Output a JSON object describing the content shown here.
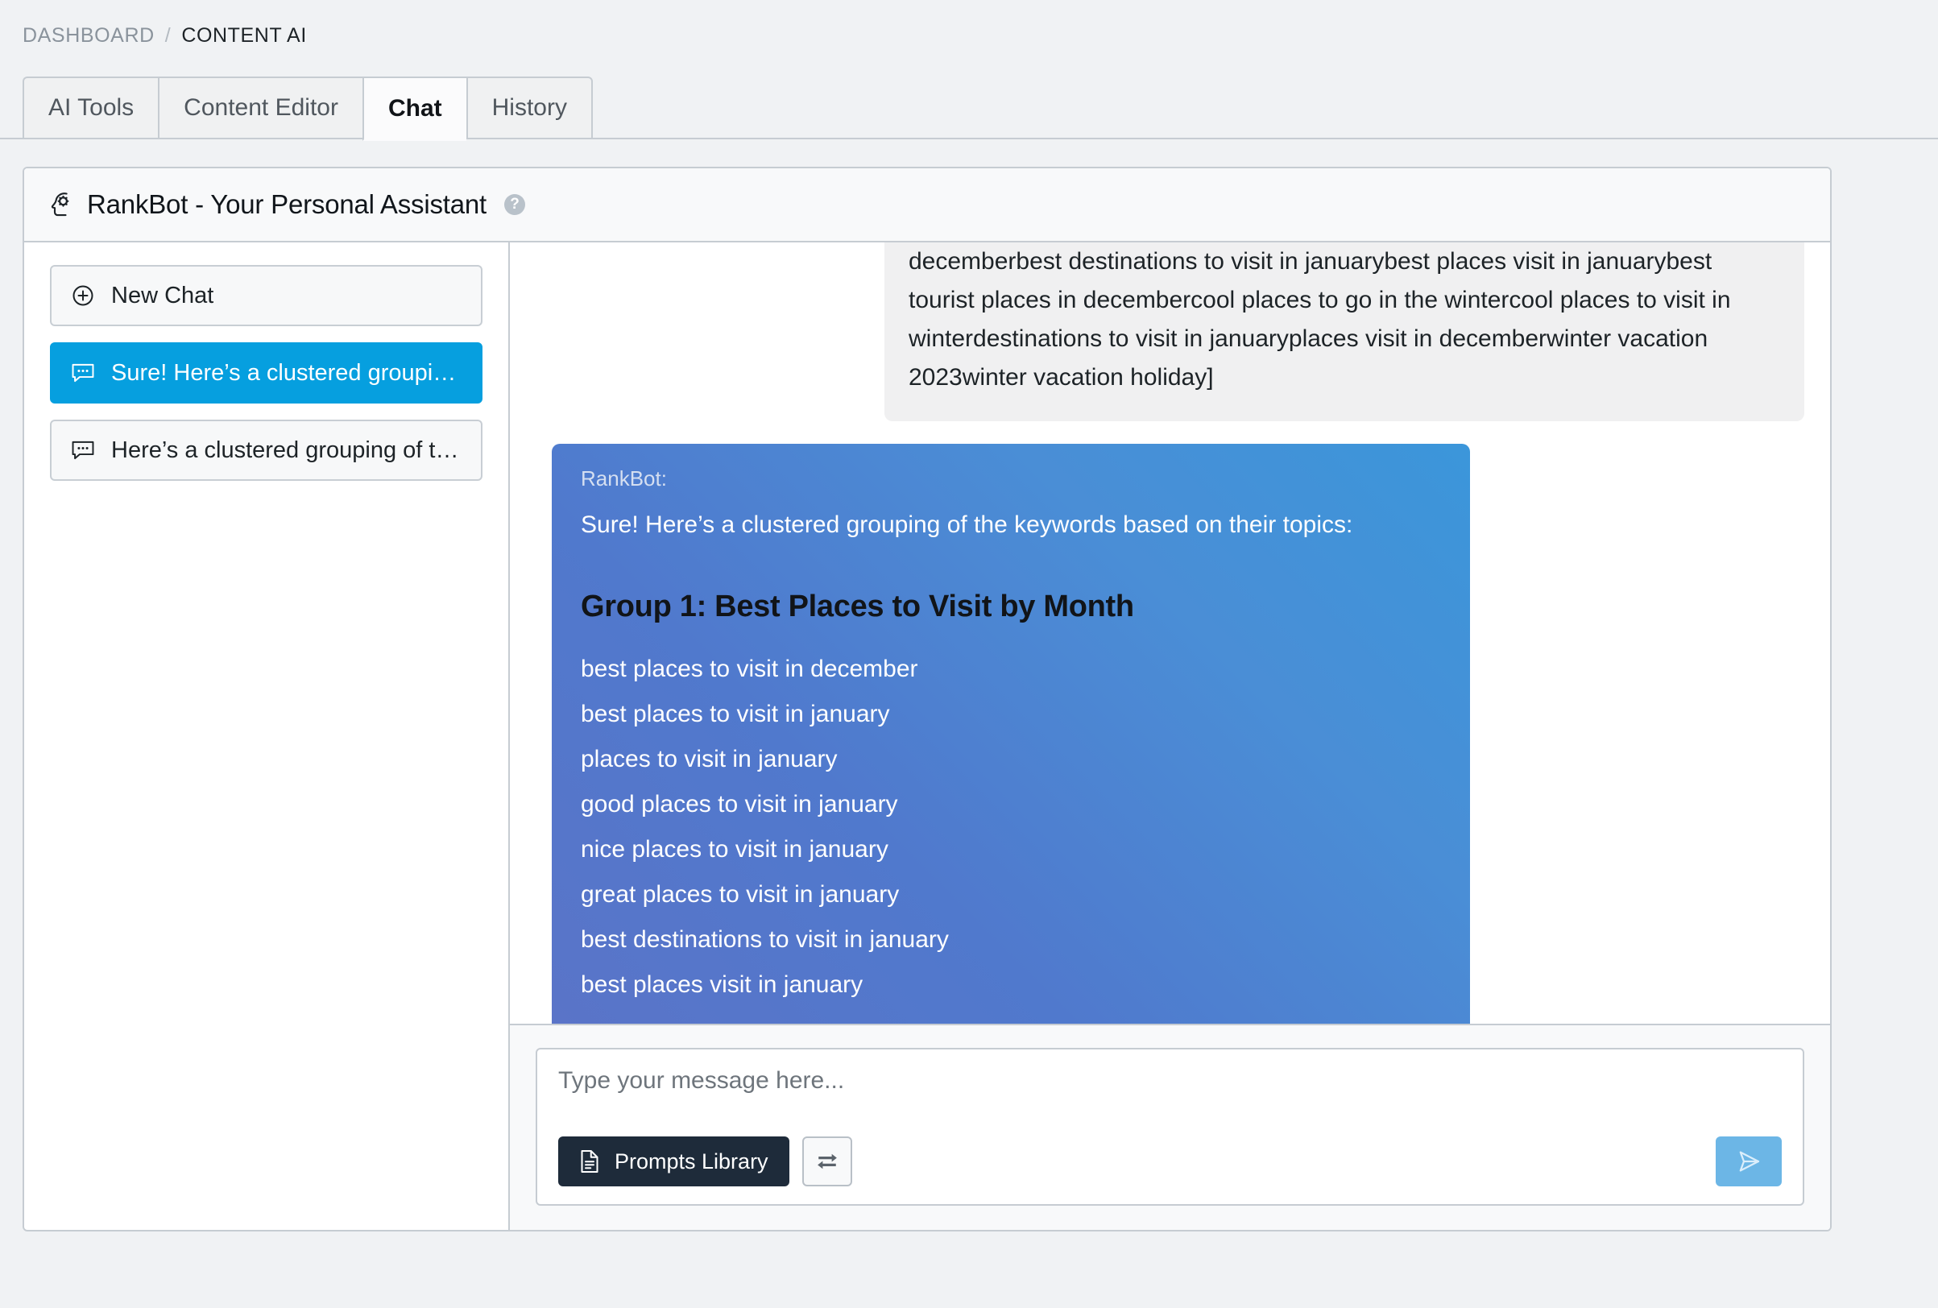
{
  "breadcrumb": {
    "parent": "DASHBOARD",
    "separator": "/",
    "current": "CONTENT AI"
  },
  "tabs": [
    {
      "label": "AI Tools",
      "active": false
    },
    {
      "label": "Content Editor",
      "active": false
    },
    {
      "label": "Chat",
      "active": true
    },
    {
      "label": "History",
      "active": false
    }
  ],
  "panel": {
    "title": "RankBot - Your Personal Assistant",
    "title_icon": "head-gear-icon",
    "help_icon": "help-circle-icon",
    "help_label": "?"
  },
  "sidebar": {
    "new_chat": {
      "label": "New Chat",
      "icon": "plus-circle-icon"
    },
    "items": [
      {
        "label": "Sure! Here’s a clustered groupin...",
        "icon": "chat-bubble-icon",
        "active": true
      },
      {
        "label": "Here’s a clustered grouping of th...",
        "icon": "chat-bubble-icon",
        "active": false
      }
    ]
  },
  "conversation": {
    "user_message": "decemberbest destinations to visit in januarybest places visit in januarybest tourist places in decembercool places to go in the wintercool places to visit in winterdestinations to visit in januaryplaces visit in decemberwinter vacation 2023winter vacation holiday]",
    "bot_message": {
      "sender": "RankBot:",
      "intro": "Sure! Here’s a clustered grouping of the keywords based on their topics:",
      "group_heading": "Group 1: Best Places to Visit by Month",
      "keywords": [
        "best places to visit in december",
        "best places to visit in january",
        "places to visit in january",
        "good places to visit in january",
        "nice places to visit in january",
        "great places to visit in january",
        "best destinations to visit in january",
        "best places visit in january"
      ]
    }
  },
  "composer": {
    "placeholder": "Type your message here...",
    "value": "",
    "prompts_library_label": "Prompts Library",
    "prompts_library_icon": "file-lines-icon",
    "swap_icon": "repeat-arrows-icon",
    "send_icon": "send-plane-icon"
  },
  "colors": {
    "accent_blue": "#069fdf",
    "bubble_gradient_start": "#5a74c8",
    "bubble_gradient_end": "#3b96da",
    "dark_button": "#1e2b3a",
    "send_button": "#6cb6e6",
    "border": "#c6ccd2",
    "page_bg": "#f0f2f4"
  }
}
